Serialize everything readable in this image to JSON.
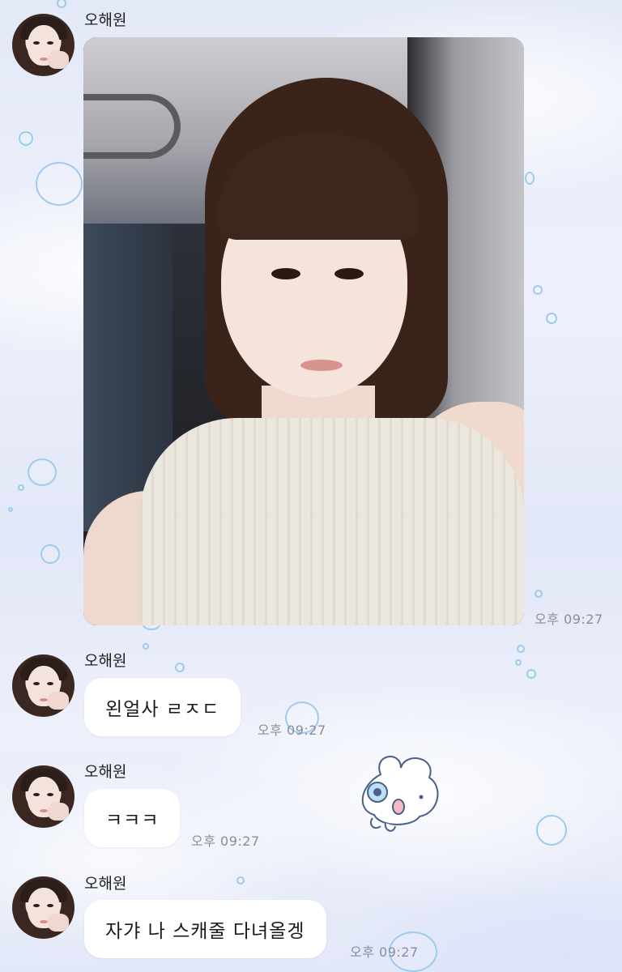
{
  "chat": {
    "messages": [
      {
        "sender": "오해원",
        "type": "image",
        "time": "오후 09:27"
      },
      {
        "sender": "오해원",
        "type": "text",
        "text": "왼얼사 ㄹㅈㄷ",
        "time": "오후 09:27"
      },
      {
        "sender": "오해원",
        "type": "text",
        "text": "ㅋㅋㅋ",
        "time": "오후 09:27"
      },
      {
        "sender": "오해원",
        "type": "text",
        "text": "자갸 나 스캐줄 다녀올겡",
        "time": "오후 09:27"
      }
    ]
  },
  "icons": {
    "avatar": "profile-photo",
    "sticker": "white-bunny-sticker"
  },
  "colors": {
    "bubble": "#ffffff",
    "time_text": "#8a8d99",
    "background": "#e8ecf9",
    "deco_bubble": "#9ccbef"
  }
}
